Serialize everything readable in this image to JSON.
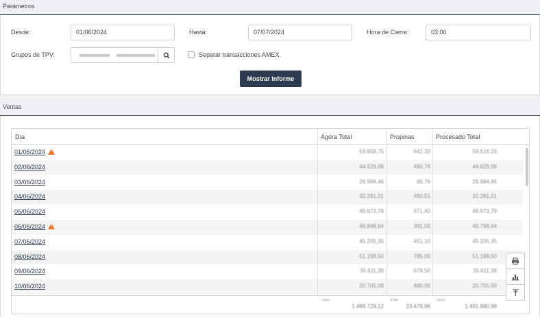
{
  "sections": {
    "params_title": "Parámetros",
    "ventas_title": "Ventas"
  },
  "params": {
    "desde_label": "Desde:",
    "desde_value": "01/06/2024",
    "hasta_label": "Hasta:",
    "hasta_value": "07/07/2024",
    "hora_label": "Hora de Cierre:",
    "hora_value": "03:00",
    "grupos_label": "Grupos de TPV:",
    "amex_label": "Separar transacciones AMEX.",
    "mostrar_label": "Mostrar Informe"
  },
  "table": {
    "columns": [
      "Día",
      "Ágora Total",
      "Propinas",
      "Procesado Total"
    ],
    "rows": [
      {
        "dia": "01/06/2024",
        "agora": "59.858,75",
        "propinas": "642,33",
        "procesado": "59.516,33",
        "warning": true
      },
      {
        "dia": "02/06/2024",
        "agora": "44.629,06",
        "propinas": "490,74",
        "procesado": "44.629,06",
        "warning": false
      },
      {
        "dia": "03/06/2024",
        "agora": "26.984,46",
        "propinas": "86,76",
        "procesado": "26.984,46",
        "warning": false
      },
      {
        "dia": "04/06/2024",
        "agora": "32.281,01",
        "propinas": "480,51",
        "procesado": "32.281,01",
        "warning": false
      },
      {
        "dia": "05/06/2024",
        "agora": "46.673,79",
        "propinas": "971,40",
        "procesado": "46.673,79",
        "warning": false
      },
      {
        "dia": "06/06/2024",
        "agora": "46.848,64",
        "propinas": "391,00",
        "procesado": "46.798,44",
        "warning": true
      },
      {
        "dia": "07/06/2024",
        "agora": "45.205,35",
        "propinas": "451,10",
        "procesado": "45.205,35",
        "warning": false
      },
      {
        "dia": "08/06/2024",
        "agora": "51.198,50",
        "propinas": "785,00",
        "procesado": "51.198,50",
        "warning": false
      },
      {
        "dia": "09/06/2024",
        "agora": "35.611,38",
        "propinas": "679,50",
        "procesado": "35.611,38",
        "warning": false
      },
      {
        "dia": "10/06/2024",
        "agora": "20.705,08",
        "propinas": "480,00",
        "procesado": "20.705,00",
        "warning": false
      }
    ],
    "footer": {
      "label": "Total:",
      "agora": "1.489.729,12",
      "propinas": "23.478,96",
      "procesado": "1.491.880,99"
    }
  },
  "icons": {
    "search": "search-icon",
    "warning": "warning-icon",
    "print": "print-icon",
    "chart": "chart-icon",
    "filter": "filter-icon"
  },
  "colors": {
    "primary_button": "#2c3b4f",
    "warning": "#e8762b",
    "link": "#2b3a55"
  }
}
